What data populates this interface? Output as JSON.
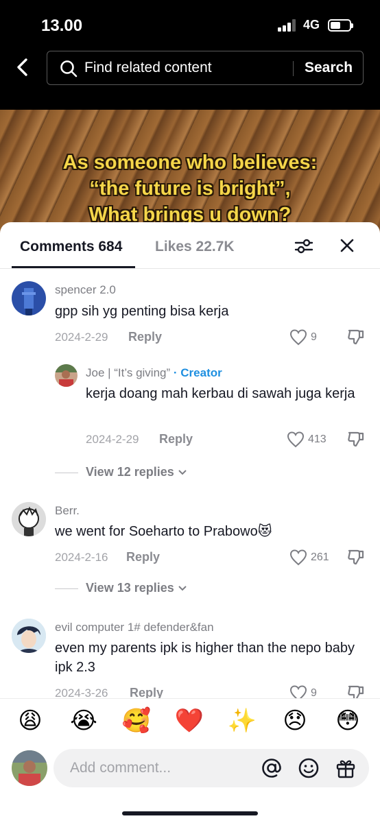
{
  "status_bar": {
    "time": "13.00",
    "network": "4G"
  },
  "search": {
    "placeholder": "Find related content",
    "button_label": "Search"
  },
  "video": {
    "caption_lines": [
      "As someone who believes:",
      "“the future is bright”,",
      "What brings u down?"
    ]
  },
  "tabs": {
    "comments_label": "Comments 684",
    "likes_label": "Likes 22.7K"
  },
  "comments": [
    {
      "username": "spencer 2.0",
      "text": "gpp sih yg penting bisa kerja",
      "date": "2024-2-29",
      "reply_label": "Reply",
      "likes": "9"
    },
    {
      "username": "Joe | “It’s giving”",
      "badge": "· Creator",
      "text": "kerja doang mah kerbau di sawah juga kerja",
      "date": "2024-2-29",
      "reply_label": "Reply",
      "likes": "413"
    },
    {
      "username": "Berr.",
      "text": "we went for Soeharto to Prabowo😻",
      "date": "2024-2-16",
      "reply_label": "Reply",
      "likes": "261"
    },
    {
      "username": "evil computer 1# defender&fan",
      "text": "even my parents ipk is higher than the nepo baby ipk 2.3",
      "date": "2024-3-26",
      "reply_label": "Reply",
      "likes": "9"
    }
  ],
  "view_replies": [
    "View 12 replies",
    "View 13 replies"
  ],
  "emoji_bar": [
    "😩",
    "😭",
    "🥰",
    "❤️",
    "✨",
    "😞",
    "😳"
  ],
  "input": {
    "placeholder": "Add comment..."
  },
  "icons": [
    "back-arrow-icon",
    "search-icon",
    "filter-icon",
    "close-icon",
    "heart-icon",
    "dislike-icon",
    "chevron-down-icon",
    "at-icon",
    "emoji-icon",
    "gift-icon"
  ],
  "colors": {
    "accent_creator": "#1e8fe0",
    "text_primary": "#161823",
    "text_secondary": "#7c7d83"
  }
}
